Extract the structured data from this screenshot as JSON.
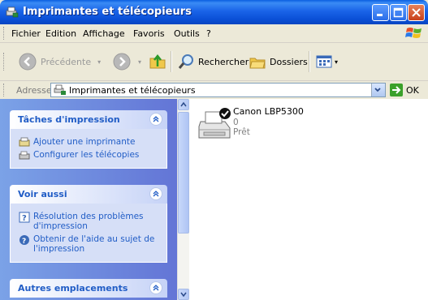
{
  "window": {
    "title": "Imprimantes et télécopieurs"
  },
  "menu": {
    "items": [
      "Fichier",
      "Edition",
      "Affichage",
      "Favoris",
      "Outils",
      "?"
    ]
  },
  "toolbar": {
    "back_label": "Précédente",
    "search_label": "Rechercher",
    "folders_label": "Dossiers"
  },
  "address": {
    "label": "Adresse",
    "value": "Imprimantes et télécopieurs",
    "go_label": "OK"
  },
  "tasks": {
    "title": "Tâches d'impression",
    "items": [
      {
        "label": "Ajouter une imprimante",
        "icon": "add-printer-icon"
      },
      {
        "label": "Configurer les télécopies",
        "icon": "fax-icon"
      }
    ]
  },
  "see_also": {
    "title": "Voir aussi",
    "items": [
      {
        "label": "Résolution des problèmes d'impression",
        "icon": "help-icon"
      },
      {
        "label": "Obtenir de l'aide au sujet de l'impression",
        "icon": "help-globe-icon"
      }
    ]
  },
  "other_places": {
    "title": "Autres emplacements"
  },
  "printers": [
    {
      "name": "Canon LBP5300",
      "documents": "0",
      "status": "Prêt"
    }
  ],
  "colors": {
    "title_bar": "#0a4fd6",
    "task_text": "#215dc6",
    "left_pane": "#7ba2e7"
  }
}
